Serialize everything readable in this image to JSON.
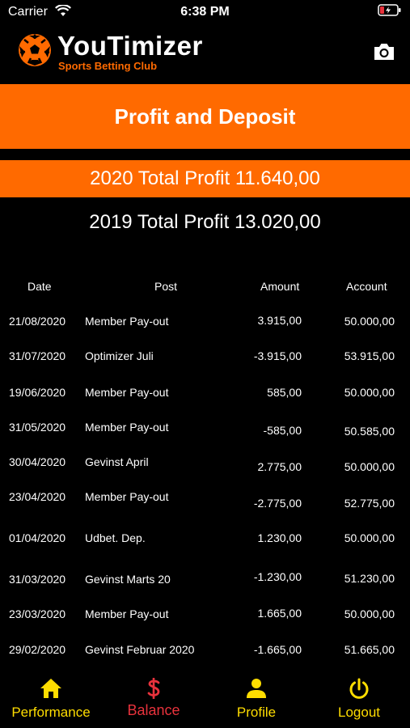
{
  "status_bar": {
    "carrier": "Carrier",
    "time": "6:38 PM"
  },
  "header": {
    "brand": "YouTimizer",
    "tagline": "Sports Betting Club",
    "camera_icon": "camera-icon",
    "logo_icon": "soccer-ball-icon"
  },
  "banner": {
    "title": "Profit and Deposit"
  },
  "summary": {
    "profit_2020": "2020 Total Profit 11.640,00",
    "profit_2019": "2019 Total Profit 13.020,00"
  },
  "table": {
    "headers": {
      "date": "Date",
      "post": "Post",
      "amount": "Amount",
      "account": "Account"
    },
    "rows": [
      {
        "date": "21/08/2020",
        "post": "Member Pay-out",
        "amount": "3.915,00",
        "account": "50.000,00"
      },
      {
        "date": "31/07/2020",
        "post": "Optimizer Juli",
        "amount": "-3.915,00",
        "account": "53.915,00"
      },
      {
        "date": "19/06/2020",
        "post": "Member Pay-out",
        "amount": "585,00",
        "account": "50.000,00"
      },
      {
        "date": "31/05/2020",
        "post": "Member Pay-out",
        "amount": "-585,00",
        "account": "50.585,00"
      },
      {
        "date": "30/04/2020",
        "post": "Gevinst April",
        "amount": "2.775,00",
        "account": "50.000,00"
      },
      {
        "date": "23/04/2020",
        "post": "Member Pay-out",
        "amount": "-2.775,00",
        "account": "52.775,00"
      },
      {
        "date": "01/04/2020",
        "post": "Udbet. Dep.",
        "amount": "1.230,00",
        "account": "50.000,00"
      },
      {
        "date": "31/03/2020",
        "post": "Gevinst Marts 20",
        "amount": "-1.230,00",
        "account": "51.230,00"
      },
      {
        "date": "23/03/2020",
        "post": "Member Pay-out",
        "amount": "1.665,00",
        "account": "50.000,00"
      },
      {
        "date": "29/02/2020",
        "post": "Gevinst Februar 2020",
        "amount": "-1.665,00",
        "account": "51.665,00"
      }
    ]
  },
  "tabs": {
    "performance": {
      "label": "Performance",
      "icon": "home-icon"
    },
    "balance": {
      "label": "Balance",
      "icon": "dollar-icon",
      "active": true
    },
    "profile": {
      "label": "Profile",
      "icon": "person-icon"
    },
    "logout": {
      "label": "Logout",
      "icon": "power-icon"
    }
  },
  "colors": {
    "accent": "#ff6a00",
    "tab_yellow": "#ffdd00",
    "active_red": "#e8323c",
    "background": "#000000"
  }
}
